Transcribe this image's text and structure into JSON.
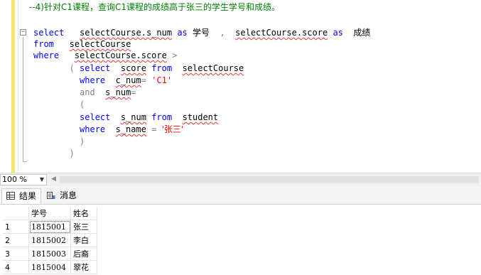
{
  "editor": {
    "lines": [
      [
        {
          "t": "--4)针对C1课程，查询C1课程的成绩高于张三的学生学号和成绩。",
          "c": "cm"
        }
      ],
      [
        {
          "t": "select",
          "c": "kw"
        },
        {
          "t": "   ",
          "c": "id-plain"
        },
        {
          "t": "selectCourse.s_num",
          "c": "id"
        },
        {
          "t": " ",
          "c": "id-plain"
        },
        {
          "t": "as",
          "c": "kw"
        },
        {
          "t": " ",
          "c": "id-plain"
        },
        {
          "t": "学号",
          "c": "id-plain cn"
        },
        {
          "t": "  ,  ",
          "c": "gray"
        },
        {
          "t": "selectCourse.score",
          "c": "id"
        },
        {
          "t": " ",
          "c": "id-plain"
        },
        {
          "t": "as",
          "c": "kw"
        },
        {
          "t": "  ",
          "c": "id-plain"
        },
        {
          "t": "成绩",
          "c": "id-plain cn"
        }
      ],
      [
        {
          "t": "from",
          "c": "kw"
        },
        {
          "t": "   ",
          "c": "id-plain"
        },
        {
          "t": "selectCourse",
          "c": "id"
        }
      ],
      [
        {
          "t": "where",
          "c": "kw"
        },
        {
          "t": "   ",
          "c": "id-plain"
        },
        {
          "t": "selectCourse.score",
          "c": "id"
        },
        {
          "t": " >",
          "c": "gray"
        }
      ],
      [
        {
          "t": "       ( ",
          "c": "gray"
        },
        {
          "t": "select",
          "c": "kw"
        },
        {
          "t": "  ",
          "c": "id-plain"
        },
        {
          "t": "score",
          "c": "id"
        },
        {
          "t": " ",
          "c": "id-plain"
        },
        {
          "t": "from",
          "c": "kw"
        },
        {
          "t": "  ",
          "c": "id-plain"
        },
        {
          "t": "selectCourse",
          "c": "id"
        }
      ],
      [
        {
          "t": "         ",
          "c": "id-plain"
        },
        {
          "t": "where",
          "c": "kw"
        },
        {
          "t": "  ",
          "c": "id-plain"
        },
        {
          "t": "c_num",
          "c": "id"
        },
        {
          "t": "= ",
          "c": "gray"
        },
        {
          "t": "'C1'",
          "c": "str"
        }
      ],
      [
        {
          "t": "         ",
          "c": "id-plain"
        },
        {
          "t": "and",
          "c": "gray"
        },
        {
          "t": "  ",
          "c": "id-plain"
        },
        {
          "t": "s_num",
          "c": "id"
        },
        {
          "t": "=",
          "c": "gray"
        }
      ],
      [
        {
          "t": "         (",
          "c": "gray"
        }
      ],
      [
        {
          "t": "         ",
          "c": "id-plain"
        },
        {
          "t": "select",
          "c": "kw"
        },
        {
          "t": "  ",
          "c": "id-plain"
        },
        {
          "t": "s_num",
          "c": "id"
        },
        {
          "t": " ",
          "c": "id-plain"
        },
        {
          "t": "from",
          "c": "kw"
        },
        {
          "t": "  ",
          "c": "id-plain"
        },
        {
          "t": "student",
          "c": "id"
        }
      ],
      [
        {
          "t": "         ",
          "c": "id-plain"
        },
        {
          "t": "where",
          "c": "kw"
        },
        {
          "t": "  ",
          "c": "id-plain"
        },
        {
          "t": "s_name",
          "c": "id"
        },
        {
          "t": " = ",
          "c": "gray"
        },
        {
          "t": "'张三'",
          "c": "str cn"
        }
      ],
      [
        {
          "t": "         )",
          "c": "gray"
        }
      ],
      [
        {
          "t": "       )",
          "c": "gray"
        }
      ]
    ]
  },
  "statusbar": {
    "zoom": "100 %"
  },
  "tabs": {
    "results": "结果",
    "messages": "消息"
  },
  "results": {
    "columns": [
      "学号",
      "姓名"
    ],
    "rows": [
      {
        "n": "1",
        "num": "1815001",
        "name": "张三"
      },
      {
        "n": "2",
        "num": "1815002",
        "name": "李白"
      },
      {
        "n": "3",
        "num": "1815003",
        "name": "后裔"
      },
      {
        "n": "4",
        "num": "1815004",
        "name": "翠花"
      }
    ]
  }
}
